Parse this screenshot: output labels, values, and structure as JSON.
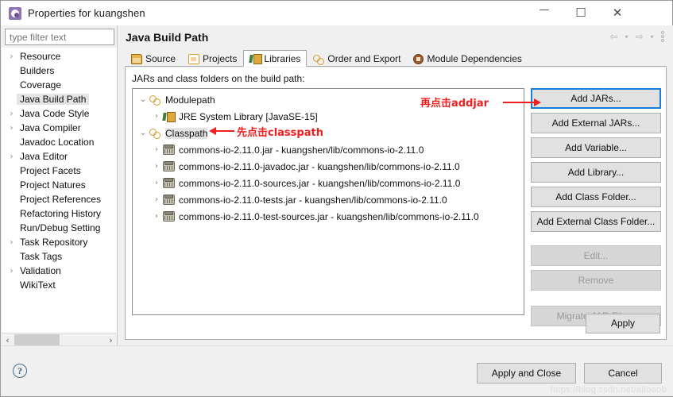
{
  "window": {
    "title": "Properties for kuangshen",
    "icon": "properties-gear-icon",
    "minimize": "—",
    "maximize": "☐",
    "close": "✕"
  },
  "filter": {
    "placeholder": "type filter text",
    "value": ""
  },
  "sidebar": {
    "items": [
      {
        "label": "Resource",
        "expandable": true,
        "selected": false
      },
      {
        "label": "Builders",
        "expandable": false,
        "selected": false
      },
      {
        "label": "Coverage",
        "expandable": false,
        "selected": false
      },
      {
        "label": "Java Build Path",
        "expandable": false,
        "selected": true
      },
      {
        "label": "Java Code Style",
        "expandable": true,
        "selected": false
      },
      {
        "label": "Java Compiler",
        "expandable": true,
        "selected": false
      },
      {
        "label": "Javadoc Location",
        "expandable": false,
        "selected": false
      },
      {
        "label": "Java Editor",
        "expandable": true,
        "selected": false
      },
      {
        "label": "Project Facets",
        "expandable": false,
        "selected": false
      },
      {
        "label": "Project Natures",
        "expandable": false,
        "selected": false
      },
      {
        "label": "Project References",
        "expandable": false,
        "selected": false
      },
      {
        "label": "Refactoring History",
        "expandable": false,
        "selected": false
      },
      {
        "label": "Run/Debug Setting",
        "expandable": false,
        "selected": false
      },
      {
        "label": "Task Repository",
        "expandable": true,
        "selected": false
      },
      {
        "label": "Task Tags",
        "expandable": false,
        "selected": false
      },
      {
        "label": "Validation",
        "expandable": true,
        "selected": false
      },
      {
        "label": "WikiText",
        "expandable": false,
        "selected": false
      }
    ],
    "scroll_left": "‹",
    "scroll_right": "›"
  },
  "page": {
    "title": "Java Build Path",
    "nav": {
      "back": "⇦",
      "back_menu": "▾",
      "forward": "⇨",
      "forward_menu": "▾",
      "view_menu": "view-menu-icon"
    }
  },
  "tabs": [
    {
      "label": "Source",
      "icon": "source-folder-icon",
      "active": false
    },
    {
      "label": "Projects",
      "icon": "projects-folder-icon",
      "active": false
    },
    {
      "label": "Libraries",
      "icon": "libraries-icon",
      "active": true
    },
    {
      "label": "Order and Export",
      "icon": "order-export-icon",
      "active": false
    },
    {
      "label": "Module Dependencies",
      "icon": "module-deps-icon",
      "active": false
    }
  ],
  "libraries": {
    "label": "JARs and class folders on the build path:",
    "tree": [
      {
        "label": "Modulepath",
        "icon": "modulepath-icon",
        "depth": 0,
        "expander": "⌄",
        "expanded": true,
        "selected": false
      },
      {
        "label": "JRE System Library [JavaSE-15]",
        "icon": "jre-library-icon",
        "depth": 1,
        "expander": "›",
        "expanded": false,
        "selected": false
      },
      {
        "label": "Classpath",
        "icon": "classpath-icon",
        "depth": 0,
        "expander": "⌄",
        "expanded": true,
        "selected": true
      },
      {
        "label": "commons-io-2.11.0.jar - kuangshen/lib/commons-io-2.11.0",
        "icon": "jar-icon",
        "depth": 1,
        "expander": "›",
        "expanded": false,
        "selected": false
      },
      {
        "label": "commons-io-2.11.0-javadoc.jar - kuangshen/lib/commons-io-2.11.0",
        "icon": "jar-icon",
        "depth": 1,
        "expander": "›",
        "expanded": false,
        "selected": false
      },
      {
        "label": "commons-io-2.11.0-sources.jar - kuangshen/lib/commons-io-2.11.0",
        "icon": "jar-icon",
        "depth": 1,
        "expander": "›",
        "expanded": false,
        "selected": false
      },
      {
        "label": "commons-io-2.11.0-tests.jar - kuangshen/lib/commons-io-2.11.0",
        "icon": "jar-icon",
        "depth": 1,
        "expander": "›",
        "expanded": false,
        "selected": false
      },
      {
        "label": "commons-io-2.11.0-test-sources.jar - kuangshen/lib/commons-io-2.11.0",
        "icon": "jar-icon",
        "depth": 1,
        "expander": "›",
        "expanded": false,
        "selected": false
      }
    ],
    "buttons": [
      {
        "label": "Add JARs...",
        "state": "focused"
      },
      {
        "label": "Add External JARs...",
        "state": "enabled"
      },
      {
        "label": "Add Variable...",
        "state": "enabled"
      },
      {
        "label": "Add Library...",
        "state": "enabled"
      },
      {
        "label": "Add Class Folder...",
        "state": "enabled"
      },
      {
        "label": "Add External Class Folder...",
        "state": "enabled"
      },
      {
        "label": "Edit...",
        "state": "disabled"
      },
      {
        "label": "Remove",
        "state": "disabled"
      },
      {
        "label": "Migrate JAR File...",
        "state": "disabled"
      }
    ],
    "apply_label": "Apply"
  },
  "footer": {
    "help": "?",
    "apply_and_close": "Apply and Close",
    "cancel": "Cancel"
  },
  "annotations": [
    {
      "id": "add-jars-note",
      "text": "再点击addjar",
      "color": "#f01f1f"
    },
    {
      "id": "classpath-note",
      "text": "先点击classpath",
      "color": "#f01f1f"
    }
  ],
  "watermark": "https://blog.csdn.net/aitoaob"
}
